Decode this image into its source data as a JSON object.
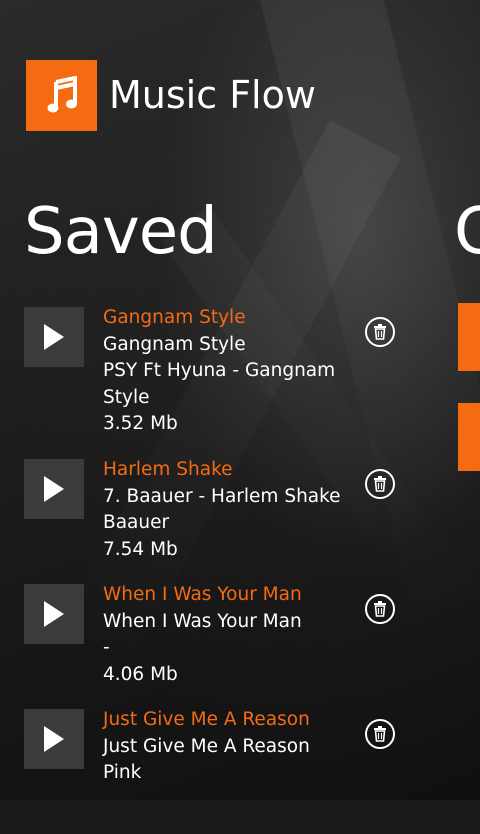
{
  "app": {
    "title": "Music Flow",
    "accent_color": "#f46b12",
    "icon": "music-note-icon"
  },
  "page": {
    "title": "Saved",
    "next_page_peek": "C"
  },
  "songs": [
    {
      "title": "Gangnam Style",
      "lines": [
        "Gangnam Style",
        "PSY Ft Hyuna - Gangnam",
        "Style"
      ],
      "size": "3.52 Mb"
    },
    {
      "title": "Harlem Shake",
      "lines": [
        "7. Baauer - Harlem Shake",
        "Baauer"
      ],
      "size": "7.54 Mb"
    },
    {
      "title": "When I Was Your Man",
      "lines": [
        "When I Was Your Man",
        "-"
      ],
      "size": "4.06 Mb"
    },
    {
      "title": "Just Give Me A Reason",
      "lines": [
        "Just Give Me A Reason",
        "Pink"
      ],
      "size": ""
    }
  ]
}
